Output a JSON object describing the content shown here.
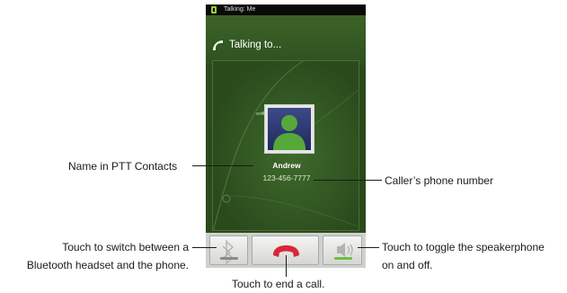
{
  "status_bar": {
    "text": "Talking: Me"
  },
  "header": {
    "title": "Talking to..."
  },
  "contact": {
    "name": "Andrew",
    "number": "123-456-7777"
  },
  "controls": {
    "bluetooth_icon": "bluetooth-icon",
    "end_call_icon": "phone-hangup-icon",
    "speaker_icon": "speaker-icon",
    "end_call_color": "#d8263b",
    "speaker_led_color": "#6cc04a"
  },
  "callouts": {
    "name": "Name in PTT Contacts",
    "number": "Caller’s phone number",
    "bluetooth_line1": "Touch to switch between a",
    "bluetooth_line2": "Bluetooth headset and the phone.",
    "speaker_line1": "Touch to toggle the speakerphone",
    "speaker_line2": "on and off.",
    "end_call": "Touch to end a call."
  }
}
